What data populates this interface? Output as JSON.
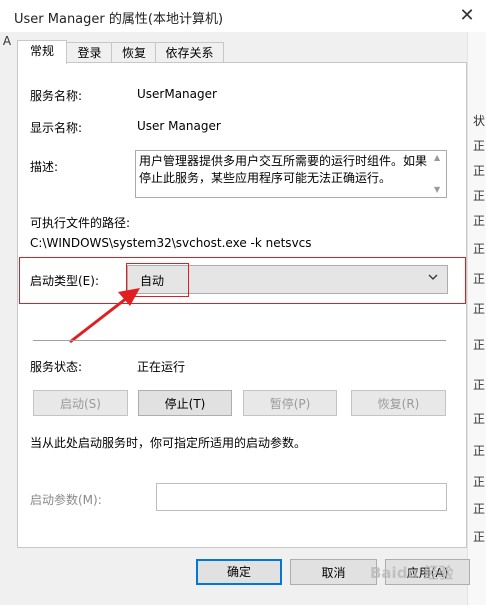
{
  "window": {
    "title": "User Manager 的属性(本地计算机)",
    "close_glyph": "✕"
  },
  "background": {
    "left_letter": "A",
    "right_letters": [
      "状",
      "正",
      "正",
      "正",
      "正",
      "正",
      "正",
      "正",
      "正",
      "正",
      "正",
      "正",
      "正",
      "正",
      "正"
    ]
  },
  "tabs": [
    {
      "label": "常规",
      "active": true
    },
    {
      "label": "登录",
      "active": false
    },
    {
      "label": "恢复",
      "active": false
    },
    {
      "label": "依存关系",
      "active": false
    }
  ],
  "general": {
    "service_name_label": "服务名称:",
    "service_name_value": "UserManager",
    "display_name_label": "显示名称:",
    "display_name_value": "User Manager",
    "description_label": "描述:",
    "description_value": "用户管理器提供多用户交互所需要的运行时组件。如果停止此服务，某些应用程序可能无法正确运行。",
    "exe_path_label": "可执行文件的路径:",
    "exe_path_value": "C:\\WINDOWS\\system32\\svchost.exe -k netsvcs",
    "startup_type_label": "启动类型(E):",
    "startup_type_value": "自动",
    "service_status_label": "服务状态:",
    "service_status_value": "正在运行",
    "buttons": {
      "start": "启动(S)",
      "stop": "停止(T)",
      "pause": "暂停(P)",
      "resume": "恢复(R)"
    },
    "hint": "当从此处启动服务时，你可指定所适用的启动参数。",
    "start_params_label": "启动参数(M):",
    "start_params_value": ""
  },
  "footer": {
    "ok": "确定",
    "cancel": "取消",
    "apply": "应用(A)"
  },
  "annotation": {
    "color": "#e02020"
  },
  "watermark": "Baidu 经验"
}
